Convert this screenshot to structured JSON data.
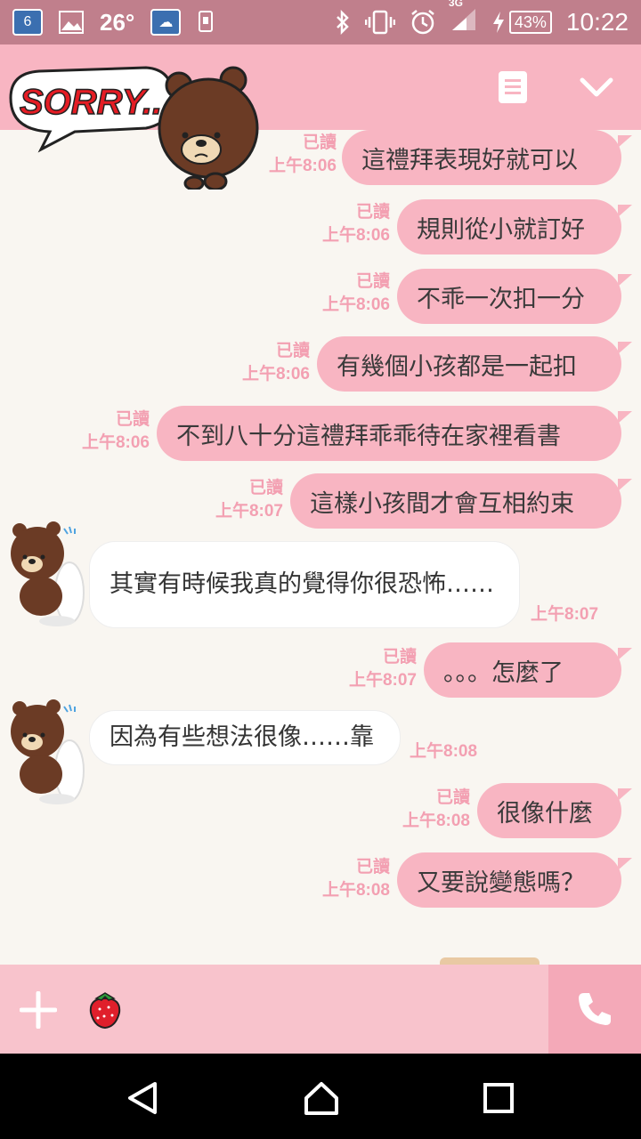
{
  "status_bar": {
    "calendar_day": "6",
    "temperature": "26°",
    "network": "3G",
    "battery": "43%",
    "time": "10:22"
  },
  "header": {
    "sticker_text": "SORRY..."
  },
  "messages": [
    {
      "side": "sent",
      "text": "這禮拜表現好就可以",
      "read": "已讀",
      "time": "上午8:06"
    },
    {
      "side": "sent",
      "text": "規則從小就訂好",
      "read": "已讀",
      "time": "上午8:06"
    },
    {
      "side": "sent",
      "text": "不乖一次扣一分",
      "read": "已讀",
      "time": "上午8:06"
    },
    {
      "side": "sent",
      "text": "有幾個小孩都是一起扣",
      "read": "已讀",
      "time": "上午8:06"
    },
    {
      "side": "sent",
      "text": "不到八十分這禮拜乖乖待在家裡看書",
      "read": "已讀",
      "time": "上午8:06"
    },
    {
      "side": "sent",
      "text": "這樣小孩間才會互相約束",
      "read": "已讀",
      "time": "上午8:07"
    },
    {
      "side": "received",
      "text": "其實有時候我真的覺得你很恐怖……",
      "time": "上午8:07"
    },
    {
      "side": "sent",
      "text": "。。。怎麼了",
      "read": "已讀",
      "time": "上午8:07"
    },
    {
      "side": "received",
      "text": "因為有些想法很像……靠",
      "time": "上午8:08"
    },
    {
      "side": "sent",
      "text": "很像什麼",
      "read": "已讀",
      "time": "上午8:08"
    },
    {
      "side": "sent",
      "text": "又要說變態嗎？",
      "read": "已讀",
      "time": "上午8:08"
    }
  ],
  "colors": {
    "sent_bubble": "#f8b5c2",
    "header": "#f8b5c2",
    "status_bar": "#c07f8c",
    "meta_text": "#f3a0b2"
  },
  "icons": [
    "calendar-icon",
    "gallery-icon",
    "weather-icon",
    "sync-icon",
    "bluetooth-icon",
    "vibrate-icon",
    "alarm-icon",
    "signal-icon",
    "charging-icon",
    "menu-icon",
    "chevron-down-icon",
    "plus-icon",
    "strawberry-icon",
    "phone-icon",
    "back-icon",
    "home-icon",
    "recents-icon"
  ]
}
